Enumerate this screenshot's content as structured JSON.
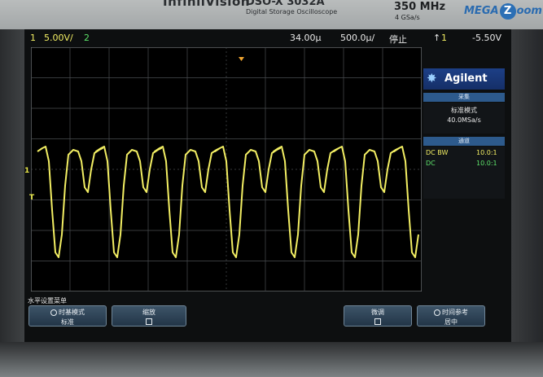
{
  "header": {
    "brand": "InfiniiVision",
    "model": "DSO-X 3032A",
    "model_sub": "Digital Storage Oscilloscope",
    "bandwidth": "350 MHz",
    "sample_rate": "4 GSa/s",
    "logo": "MEGA",
    "logo_tail": "oom"
  },
  "status": {
    "ch1": "1",
    "ch1_scale": "5.00V/",
    "ch2": "2",
    "delay": "34.00µ",
    "timebase": "500.0µ/",
    "run_state": "停止",
    "trig_ch": "1",
    "trig_level": "-5.50V"
  },
  "panel": {
    "brand": "Agilent",
    "acq_title": "采集",
    "acq_mode": "标准模式",
    "acq_rate": "40.0MSa/s",
    "chan_title": "通道",
    "ch1_coupling": "DC BW",
    "ch1_probe": "10.0:1",
    "ch2_coupling": "DC",
    "ch2_probe": "10.0:1"
  },
  "markers": {
    "ch1": "1",
    "trigger": "T"
  },
  "menu": {
    "title": "水平设置菜单",
    "keys": [
      {
        "l1": "时基模式",
        "l2": "标准"
      },
      {
        "l1": "缩放",
        "l2": ""
      },
      {
        "l1": "微调",
        "l2": ""
      },
      {
        "l1": "时间参考",
        "l2": "居中"
      }
    ]
  },
  "colors": {
    "ch1": "#f2ee63",
    "ch2": "#5de36a",
    "grid": "#4a4e52",
    "panel_accent": "#2d5a8c"
  }
}
